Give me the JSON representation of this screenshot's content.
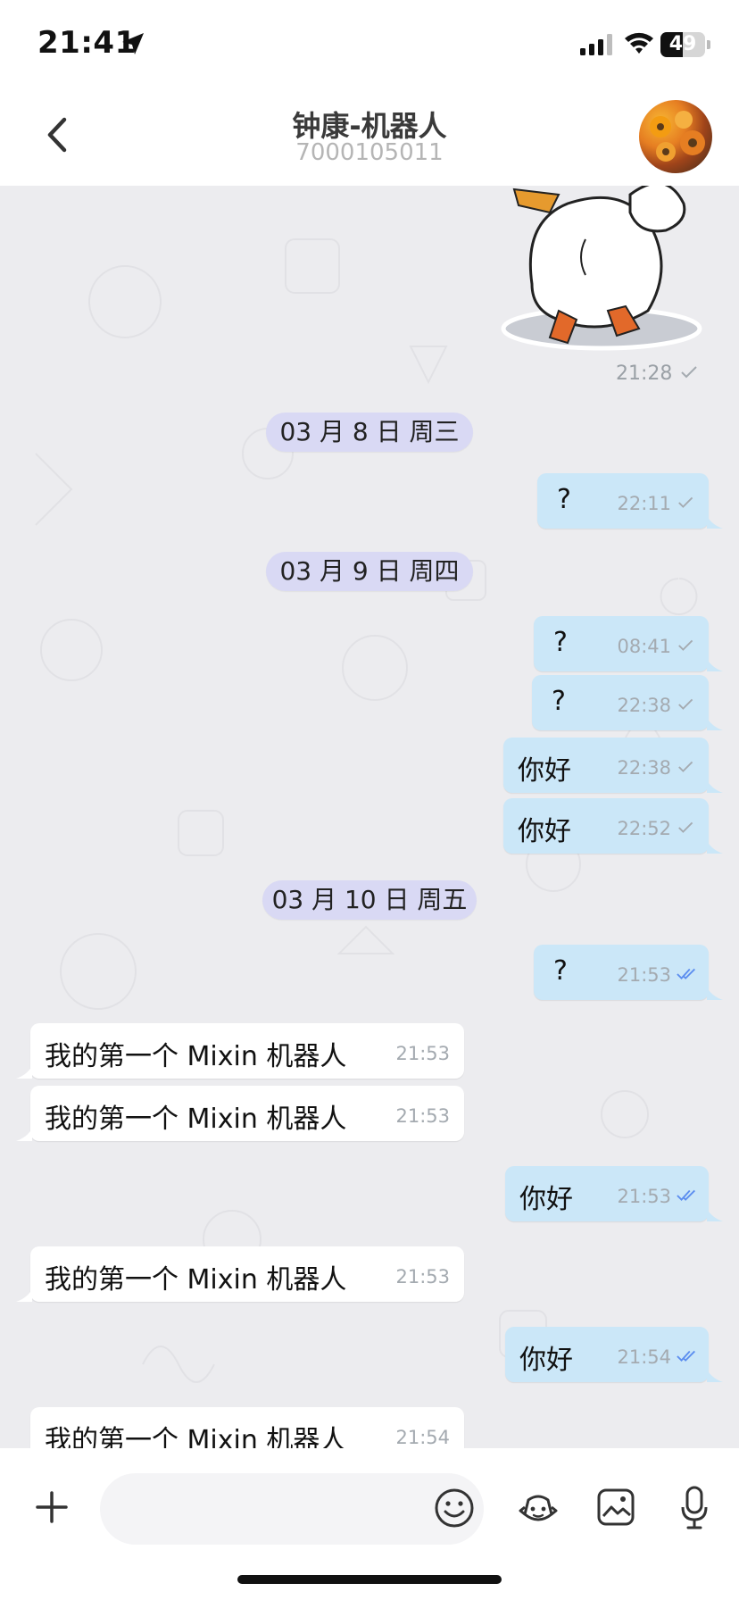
{
  "status_bar": {
    "time": "21:41",
    "battery": "49",
    "battery_level": 0.49
  },
  "header": {
    "title": "钟康-机器人",
    "subtitle": "7000105011"
  },
  "sticker": {
    "time": "21:28",
    "status": "sent"
  },
  "messages": [
    {
      "kind": "date",
      "label": "03 月 8 日 周三"
    },
    {
      "kind": "out",
      "text": "?",
      "time": "22:11",
      "status": "sent"
    },
    {
      "kind": "date",
      "label": "03 月 9 日 周四"
    },
    {
      "kind": "out",
      "text": "?",
      "time": "08:41",
      "status": "sent"
    },
    {
      "kind": "out",
      "text": "?",
      "time": "22:38",
      "status": "sent"
    },
    {
      "kind": "out",
      "text": "你好",
      "time": "22:38",
      "status": "sent"
    },
    {
      "kind": "out",
      "text": "你好",
      "time": "22:52",
      "status": "sent"
    },
    {
      "kind": "date",
      "label": "03 月 10 日 周五"
    },
    {
      "kind": "out",
      "text": "?",
      "time": "21:53",
      "status": "read"
    },
    {
      "kind": "in",
      "text": "我的第一个 Mixin 机器人",
      "time": "21:53"
    },
    {
      "kind": "in",
      "text": "我的第一个 Mixin 机器人",
      "time": "21:53"
    },
    {
      "kind": "out",
      "text": "你好",
      "time": "21:53",
      "status": "read"
    },
    {
      "kind": "in",
      "text": "我的第一个 Mixin 机器人",
      "time": "21:53"
    },
    {
      "kind": "out",
      "text": "你好",
      "time": "21:54",
      "status": "read"
    },
    {
      "kind": "in",
      "text": "我的第一个 Mixin 机器人",
      "time": "21:54"
    }
  ],
  "input": {
    "placeholder": ""
  },
  "icons": {
    "back": "chevron-left-icon",
    "add": "plus-icon",
    "emoji": "emoji-icon",
    "bot": "bot-icon",
    "image": "image-icon",
    "mic": "microphone-icon"
  },
  "colors": {
    "outgoing_bubble": "#cbe7f8",
    "incoming_bubble": "#ffffff",
    "date_pill": "#d9d9f4",
    "chat_background": "#ececef",
    "read_check": "#5b8def"
  }
}
